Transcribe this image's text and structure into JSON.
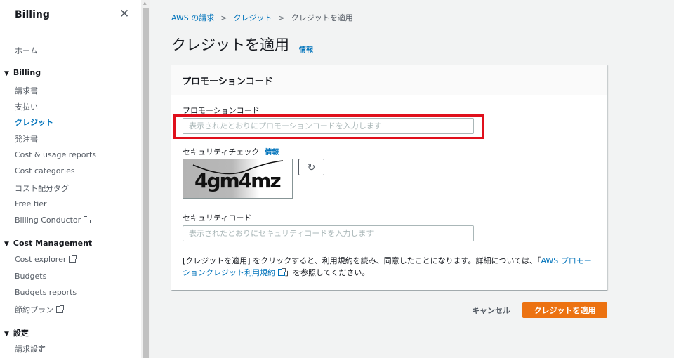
{
  "sidebar": {
    "title": "Billing",
    "home": "ホーム",
    "sections": [
      {
        "label": "Billing",
        "items": [
          "請求書",
          "支払い",
          "クレジット",
          "発注書",
          "Cost & usage reports",
          "Cost categories",
          "コスト配分タグ",
          "Free tier",
          "Billing Conductor"
        ]
      },
      {
        "label": "Cost Management",
        "items": [
          "Cost explorer",
          "Budgets",
          "Budgets reports",
          "節約プラン"
        ]
      },
      {
        "label": "設定",
        "items": [
          "請求設定"
        ]
      }
    ],
    "active_item": "クレジット"
  },
  "breadcrumb": [
    "AWS の請求",
    "クレジット",
    "クレジットを適用"
  ],
  "page": {
    "title": "クレジットを適用",
    "info": "情報"
  },
  "card": {
    "header": "プロモーションコード",
    "promo_label": "プロモーションコード",
    "promo_placeholder": "表示されたとおりにプロモーションコードを入力します",
    "security_check_label": "セキュリティチェック",
    "security_check_info": "情報",
    "captcha_text": "4gm4mz",
    "security_code_label": "セキュリティコード",
    "security_code_placeholder": "表示されたとおりにセキュリティコードを入力します",
    "terms_prefix": "[クレジットを適用] をクリックすると、利用規約を読み、同意したことになります。詳細については、「",
    "terms_link": "AWS プロモーションクレジット利用規約",
    "terms_suffix": "」を参照してください。"
  },
  "actions": {
    "cancel": "キャンセル",
    "apply": "クレジットを適用"
  },
  "colors": {
    "accent": "#0073bb",
    "primary_button": "#ec7211",
    "highlight": "#e0101c"
  }
}
